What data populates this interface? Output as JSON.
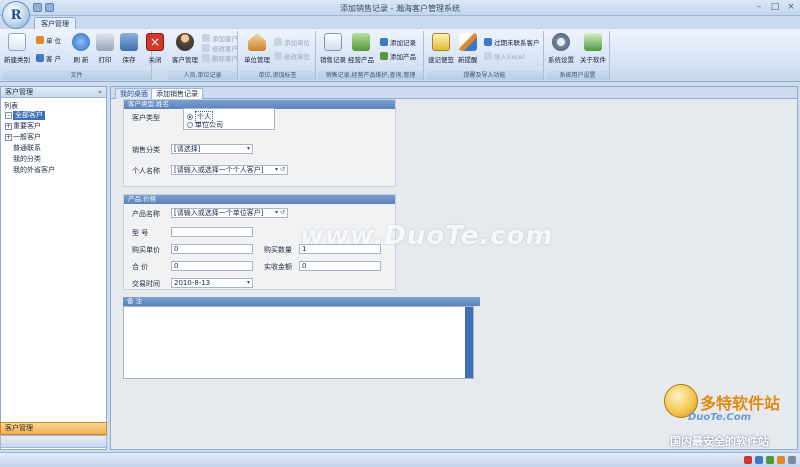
{
  "window": {
    "title": "添加销售记录 - 瀚海客户管理系统",
    "orb_glyph": "R",
    "ribbon_tab": "客户管理"
  },
  "ribbon": {
    "groups": [
      {
        "label": "文件",
        "buttons": [
          "新建类别",
          "打印",
          "保存",
          "关闭"
        ],
        "small": [
          "单 位",
          "客 户",
          "刷 新"
        ]
      },
      {
        "label": "人员,单位记录",
        "buttons": [
          "客户管理"
        ],
        "small": [
          "添加客户",
          "修改客户",
          "删除客户"
        ]
      },
      {
        "label": "单位,添加标签",
        "buttons": [
          "单位管理"
        ],
        "small": [
          "添加单位",
          "修改单位"
        ]
      },
      {
        "label": "销售记录,经营产品维护,查询,管理",
        "buttons": [
          "销售记录",
          "经营产品"
        ],
        "small": [
          "添加记录",
          "添加产品"
        ]
      },
      {
        "label": "提醒及导入功能",
        "buttons": [
          "速记便签",
          "新提醒"
        ],
        "small": [
          "过期未联系客户",
          "导入Excel"
        ]
      },
      {
        "label": "系统用户设置",
        "buttons": [
          "系统设置",
          "关于软件"
        ],
        "small": []
      }
    ],
    "colors": {
      "red_close": "#d2372c",
      "blue": "#3f78c4",
      "orange": "#e0892a",
      "green": "#4f9a3a"
    }
  },
  "sidebar": {
    "header": "客户管理",
    "tree_title": "列表",
    "items": [
      "全部客户",
      "重要客户",
      "一般客户",
      "普通联系",
      "我的分类",
      "我的外省客户"
    ],
    "bottom_label": "客户管理"
  },
  "content": {
    "tabs": [
      "我的桌面",
      "添加销售记录"
    ],
    "customer_panel": {
      "title": "客户类型,姓名",
      "type_label": "客户类型",
      "type_options": [
        "个人",
        "单位公司"
      ],
      "category_label": "销售分类",
      "category_value": "[请选择]",
      "name_label": "个人名称",
      "name_value": "[请输入或选择一个个人客户]"
    },
    "product_panel": {
      "title": "产品,价格",
      "product_label": "产品名称",
      "product_value": "[请输入或选择一个单位客户]",
      "model_label": "型    号",
      "model_value": "",
      "unit_price_label": "购买单价",
      "unit_price_value": "0",
      "qty_label": "购买数量",
      "qty_value": "1",
      "total_label": "合    价",
      "total_value": "0",
      "paid_label": "实收金额",
      "paid_value": "0",
      "date_label": "交易时间",
      "date_value": "2010-8-13"
    },
    "notes_panel": {
      "title": "备    注"
    }
  },
  "watermark": "www.DuoTe.com",
  "logo": {
    "title": "多特软件站",
    "sub": "DuoTe.Com",
    "tag": "国内最安全的软件站"
  }
}
